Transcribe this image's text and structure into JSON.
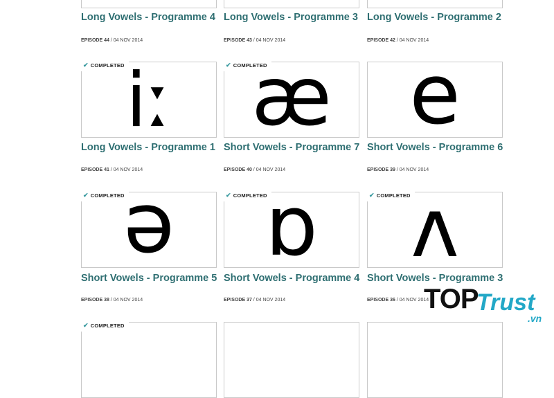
{
  "cards": [
    {
      "id": "r0c0",
      "title": "Long Vowels - Programme 4",
      "episode": "EPISODE 44",
      "date": "04 NOV 2014",
      "symbol": "",
      "completed": false
    },
    {
      "id": "r0c1",
      "title": "Long Vowels - Programme 3",
      "episode": "EPISODE 43",
      "date": "04 NOV 2014",
      "symbol": "",
      "completed": false
    },
    {
      "id": "r0c2",
      "title": "Long Vowels - Programme 2",
      "episode": "EPISODE 42",
      "date": "04 NOV 2014",
      "symbol": "",
      "completed": false
    },
    {
      "id": "r1c0",
      "title": "Long Vowels - Programme 1",
      "episode": "EPISODE 41",
      "date": "04 NOV 2014",
      "symbol": "iː",
      "completed": true
    },
    {
      "id": "r1c1",
      "title": "Short Vowels - Programme 7",
      "episode": "EPISODE 40",
      "date": "04 NOV 2014",
      "symbol": "æ",
      "completed": true
    },
    {
      "id": "r1c2",
      "title": "Short Vowels - Programme 6",
      "episode": "EPISODE 39",
      "date": "04 NOV 2014",
      "symbol": "e",
      "completed": false
    },
    {
      "id": "r2c0",
      "title": "Short Vowels - Programme 5",
      "episode": "EPISODE 38",
      "date": "04 NOV 2014",
      "symbol": "ə",
      "completed": true
    },
    {
      "id": "r2c1",
      "title": "Short Vowels - Programme 4",
      "episode": "EPISODE 37",
      "date": "04 NOV 2014",
      "symbol": "ɒ",
      "completed": true
    },
    {
      "id": "r2c2",
      "title": "Short Vowels - Programme 3",
      "episode": "EPISODE 36",
      "date": "04 NOV 2014",
      "symbol": "ʌ",
      "completed": true
    },
    {
      "id": "r3c0",
      "title": "",
      "episode": "",
      "date": "",
      "symbol": "",
      "completed": true
    },
    {
      "id": "r3c1",
      "title": "",
      "episode": "",
      "date": "",
      "symbol": "",
      "completed": false
    },
    {
      "id": "r3c2",
      "title": "",
      "episode": "",
      "date": "",
      "symbol": "",
      "completed": false
    }
  ],
  "labels": {
    "completed": "COMPLETED",
    "separator": " / "
  },
  "watermark": {
    "top": "TOP",
    "trust": "Trust",
    "vn": ".vn"
  },
  "colors": {
    "title": "#2f6f72",
    "check": "#3a9aa0",
    "watermark_accent": "#23a8c7"
  }
}
